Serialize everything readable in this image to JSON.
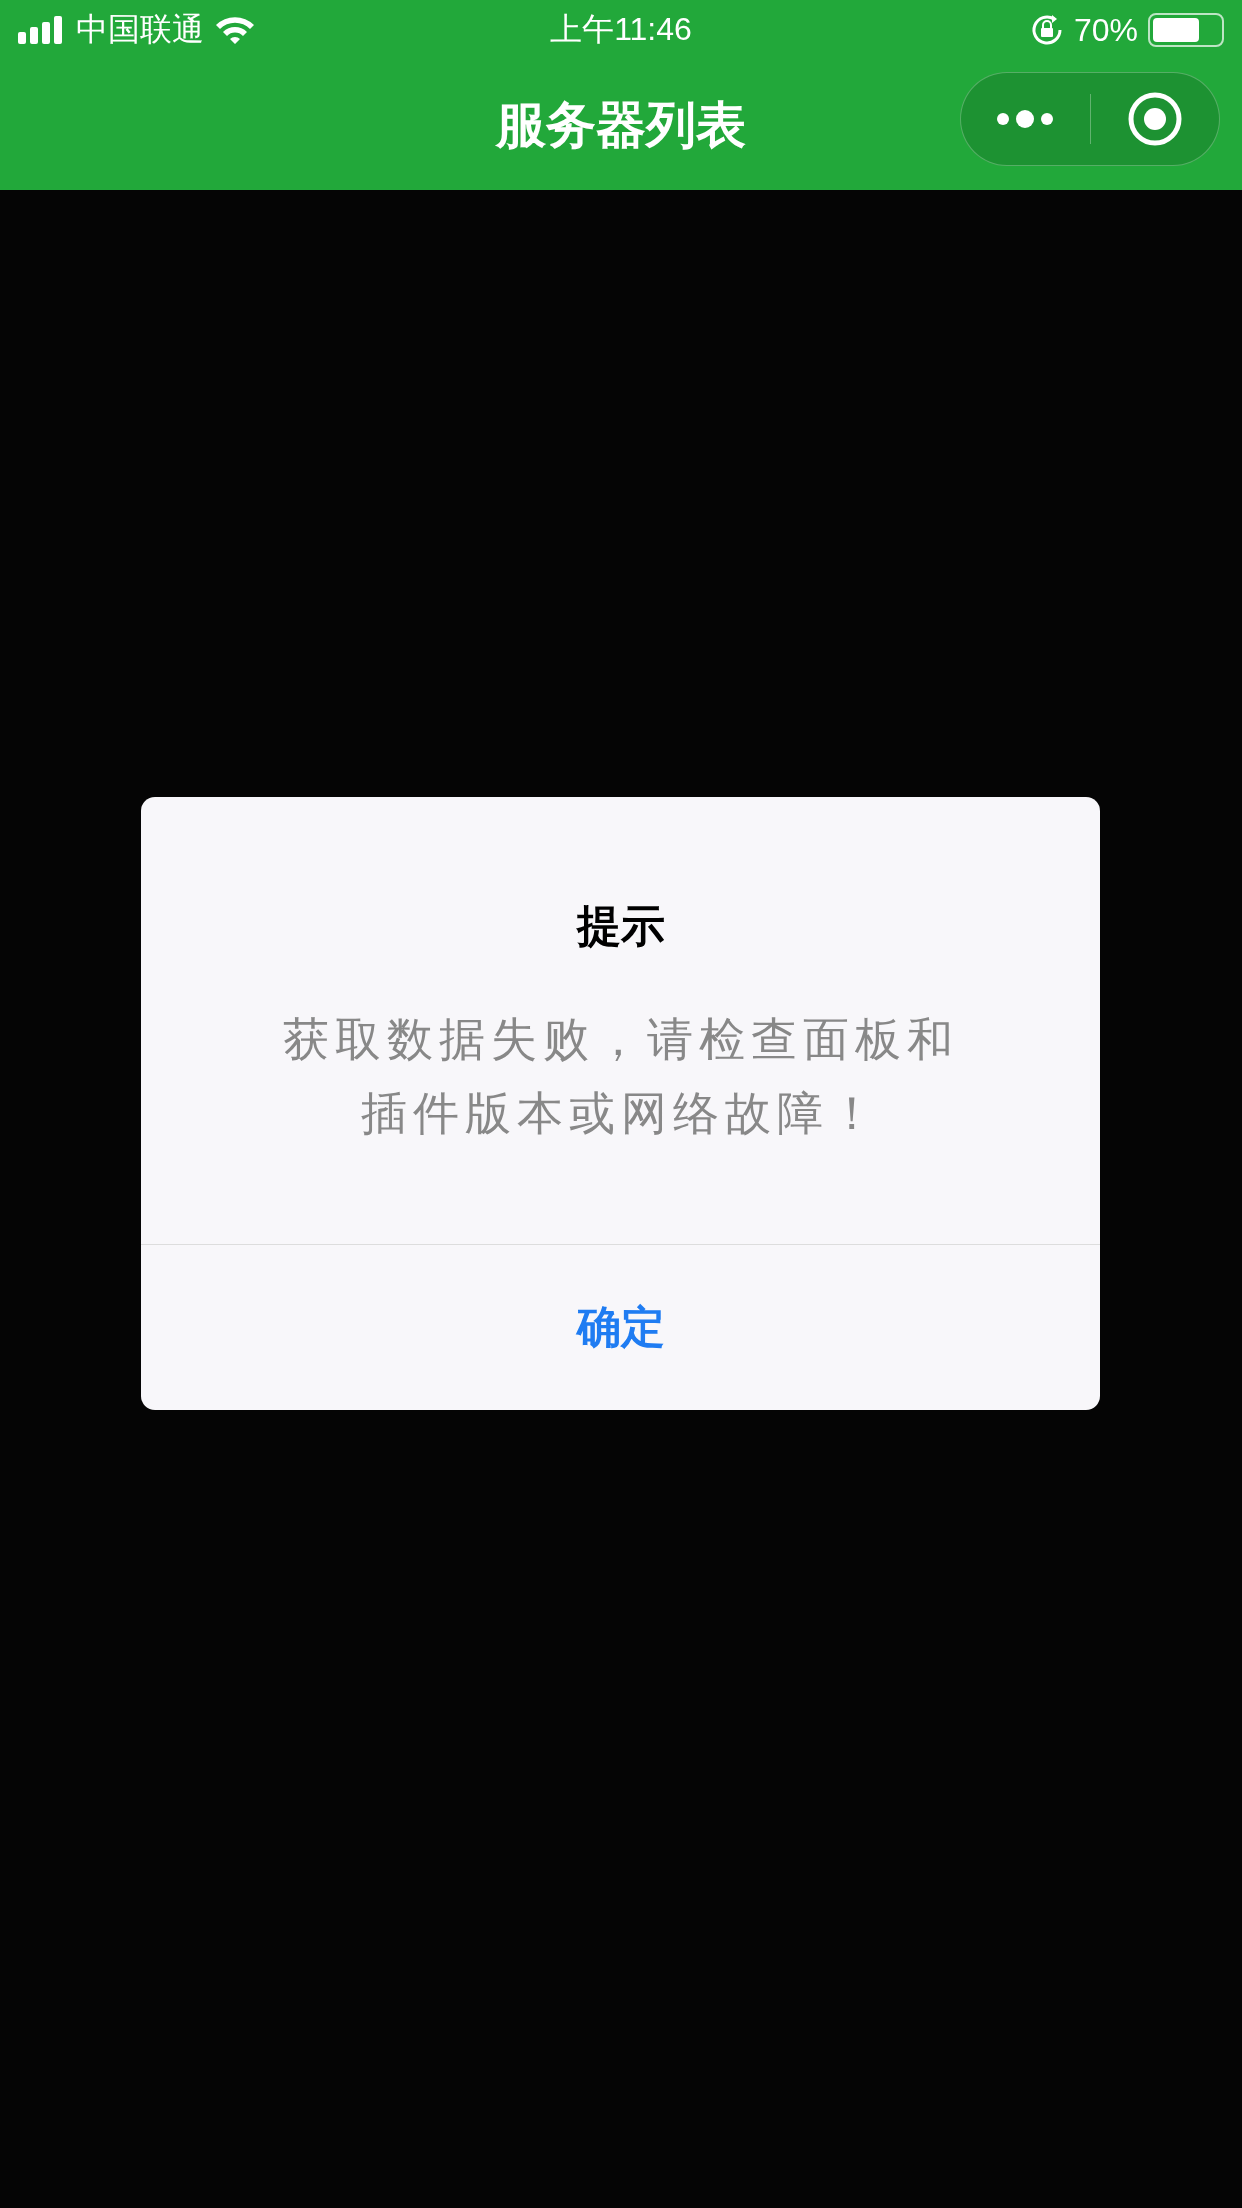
{
  "status_bar": {
    "carrier": "中国联通",
    "time": "上午11:46",
    "battery": "70%"
  },
  "nav": {
    "title": "服务器列表"
  },
  "dialog": {
    "title": "提示",
    "message": "获取数据失败，请检查面板和插件版本或网络故障！",
    "button": "确定"
  }
}
